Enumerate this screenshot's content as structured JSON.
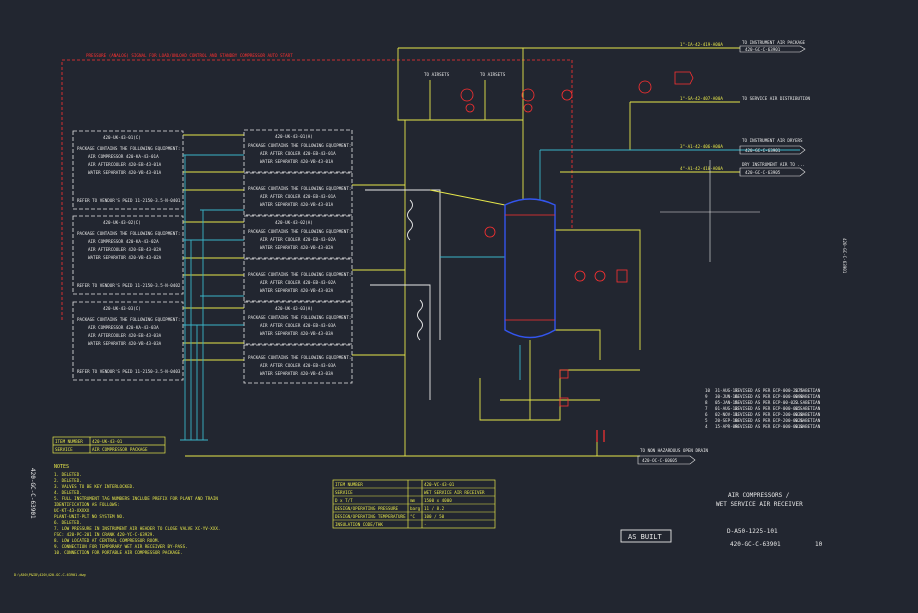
{
  "top_note": "PRESSURE (ANALOG) SIGNAL FOR LOAD/UNLOAD CONTROL AND STANDBY COMPRESSOR AUTO START",
  "airsets_labels": [
    "TO AIRSETS",
    "TO AIRSETS"
  ],
  "right_destinations": [
    {
      "line": "1\"-IA-42-419-A00A",
      "label": "TO INSTRUMENT AIR PACKAGE",
      "ref": "420-GC-C-63901"
    },
    {
      "line": "1\"-SA-42-407-A00A",
      "label": "TO SERVICE AIR DISTRIBUTION",
      "ref": ""
    },
    {
      "line": "3\"-A1-42-406-A00A",
      "label": "TO INSTRUMENT AIR DRYERS",
      "ref": "420-GC-C-63901"
    },
    {
      "line": "4\"-A1-42-418-A00A",
      "label": "DRY INSTRUMENT AIR TO ...",
      "ref": "420-GC-C-63905"
    }
  ],
  "packages": [
    {
      "tag": "420-UK-43-01(C)",
      "lines": [
        "PACKAGE CONTAINS THE FOLLOWING EQUIPMENT:",
        "AIR COMPRESSOR 420-KA-43-01A",
        "AIR AFTERCOOLER 420-EB-43-01A",
        "WATER SEPARATOR 420-VB-43-01A"
      ],
      "vendor": "REFER TO VENDOR'S P&ID 11-2150-3.5-N-0401",
      "package_label": "PACKAGE CONTAINS THE FOLLOWING EQUIPMENT:",
      "equipment": [
        "AIR AFTER COOLER 420-EB-43-01A",
        "WATER SEPARATOR 420-VB-43-01A"
      ],
      "equip_tag": "420-UK-43-01(A)"
    },
    {
      "tag": "420-UK-43-02(C)",
      "lines": [
        "PACKAGE CONTAINS THE FOLLOWING EQUIPMENT:",
        "AIR COMPRESSOR 420-KA-43-02A",
        "AIR AFTERCOOLER 420-EB-43-02A",
        "WATER SEPARATOR 420-VB-43-02A"
      ],
      "vendor": "REFER TO VENDOR'S P&ID 11-2150-3.5-N-0402",
      "package_label": "PACKAGE CONTAINS THE FOLLOWING EQUIPMENT:",
      "equipment": [
        "AIR AFTER COOLER 420-EB-43-02A",
        "WATER SEPARATOR 420-VB-43-02A"
      ],
      "equip_tag": "420-UK-43-02(A)"
    },
    {
      "tag": "420-UK-43-03(C)",
      "lines": [
        "PACKAGE CONTAINS THE FOLLOWING EQUIPMENT:",
        "AIR COMPRESSOR 420-KA-43-03A",
        "AIR AFTERCOOLER 420-EB-43-03A",
        "WATER SEPARATOR 420-VB-43-03A"
      ],
      "vendor": "REFER TO VENDOR'S P&ID 11-2150-3.5-N-0403",
      "package_label": "PACKAGE CONTAINS THE FOLLOWING EQUIPMENT:",
      "equipment": [
        "AIR AFTER COOLER 420-EB-43-03A",
        "WATER SEPARATOR 420-VB-43-03A"
      ],
      "equip_tag": "420-UK-43-03(A)"
    }
  ],
  "item_table_small": [
    {
      "k": "ITEM NUMBER",
      "v": "420-UK-43-01"
    },
    {
      "k": "SERVICE",
      "v": "AIR COMPRESSOR PACKAGE"
    }
  ],
  "item_table_main": [
    {
      "k": "ITEM NUMBER",
      "u": "",
      "v": "420-VC-43-01"
    },
    {
      "k": "SERVICE",
      "u": "",
      "v": "WET SERVICE AIR RECEIVER"
    },
    {
      "k": "D x T/T",
      "u": "mm",
      "v": "1500 x 4000"
    },
    {
      "k": "DESIGN/OPERATING PRESSURE",
      "u": "barg",
      "v": "11 / 8.2"
    },
    {
      "k": "DESIGN/OPERATING TEMPERATURE",
      "u": "°C",
      "v": "100 / 50"
    },
    {
      "k": "INSULATION CODE/THK",
      "u": "",
      "v": "-"
    }
  ],
  "notes_title": "NOTES",
  "notes": [
    "1. DELETED.",
    "2. DELETED.",
    "3. VALVES TO BE KEY INTERLOCKED.",
    "4. DELETED.",
    "5. FULL INSTRUMENT TAG NUMBERS INCLUDE PREFIX FOR PLANT AND TRAIN",
    "   IDENTIFICATION AS FOLLOWS:",
    "   UC-KT-43-XXXXX",
    "   PLANT-UNIT-PLT NO SYSTEM NO.",
    "6. DELETED.",
    "7. LOW PRESSURE IN INSTRUMENT AIR HEADER TO CLOSE VALVE XC-YV-XXX.",
    "   FSC: 420-PC-201 IN CRANK 420-YC-C-63929.",
    "8. LOW LOCATED AT CENTRAL COMPRESSOR ROOM.",
    "9. CONNECTION FOR TEMPORARY WET AIR RECEIVER BY-PASS.",
    "10. CONNECTION FOR PORTABLE AIR COMPRESSOR PACKAGE."
  ],
  "revisions": [
    {
      "rev": "10",
      "date": "31-AUG-17",
      "desc": "REVISED AS PER ECP-000-2475",
      "by": "S.SABETIAN"
    },
    {
      "rev": "9",
      "date": "30-JUN-16",
      "desc": "REVISED AS PER ECP-000-0098",
      "by": "S.SABETIAN"
    },
    {
      "rev": "8",
      "date": "05-JAN-15",
      "desc": "REVISED AS PER ECP-00-023",
      "by": "S.SABETIAN"
    },
    {
      "rev": "7",
      "date": "01-AUG-12",
      "desc": "REVISED AS PER ECP-000-045",
      "by": "S.SABETIAN"
    },
    {
      "rev": "6",
      "date": "02-NOV-11",
      "desc": "REVISED AS PER ECP-200-0038",
      "by": "S.SABETIAN"
    },
    {
      "rev": "5",
      "date": "20-SEP-10",
      "desc": "REVISED AS PER ECP-200-0026",
      "by": "S.SABETIAN"
    },
    {
      "rev": "4",
      "date": "15-APR-09",
      "desc": "REVISED AS PER ECP-000-0010",
      "by": "S.SABETIAN"
    }
  ],
  "title_block": {
    "line1": "AIR COMPRESSORS /",
    "line2": "WET SERVICE AIR RECEIVER",
    "drawing_no": "D-A50-1225-101",
    "doc_no": "420-GC-C-63901",
    "rev": "10",
    "stamp": "AS BUILT"
  },
  "drain_label": "TO NON HAZARDOUS OPEN DRAIN",
  "drain_ref": "420-OC-C-60605",
  "side_vertical_text": "420-GC-C-63901",
  "right_vertical_text": "420-GC-C-63901",
  "footer_path": "D:\\A50\\P&ID\\420\\420-GC-C-63901.dwg",
  "colors": {
    "background": "#222630",
    "process": "#e6e64a",
    "instrument": "#e8e8e8",
    "signal": "#ff3030",
    "cyan": "#3ab4c8",
    "vessel": "#3355ee"
  }
}
